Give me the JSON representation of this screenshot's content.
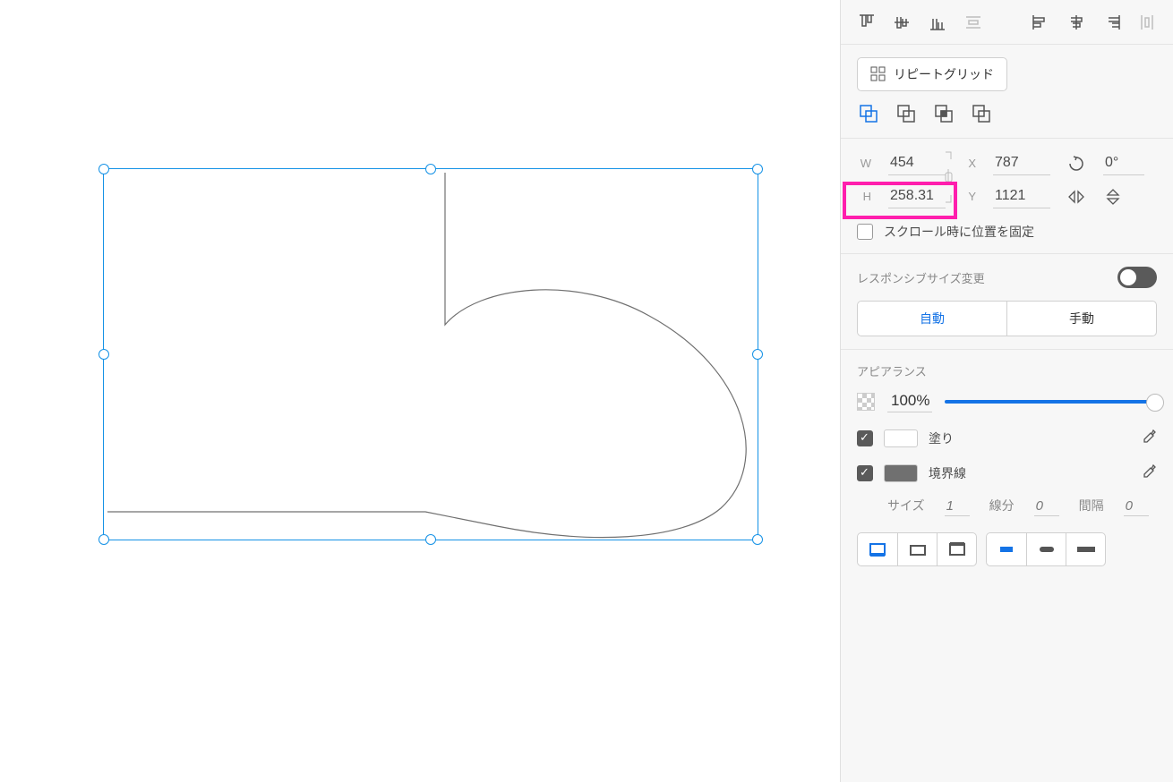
{
  "repeat_grid_label": "リピートグリッド",
  "transform": {
    "w_label": "W",
    "w": "454",
    "h_label": "H",
    "h": "258.31",
    "x_label": "X",
    "x": "787",
    "y_label": "Y",
    "y": "1121",
    "rotation": "0°"
  },
  "fix_position_label": "スクロール時に位置を固定",
  "responsive": {
    "title": "レスポンシブサイズ変更",
    "auto": "自動",
    "manual": "手動"
  },
  "appearance": {
    "title": "アピアランス",
    "opacity": "100%",
    "fill_label": "塗り",
    "fill_color": "#FFFFFF",
    "border_label": "境界線",
    "border_color": "#707070",
    "size_label": "サイズ",
    "size": "1",
    "dash_label": "線分",
    "dash": "0",
    "gap_label": "間隔",
    "gap": "0"
  }
}
